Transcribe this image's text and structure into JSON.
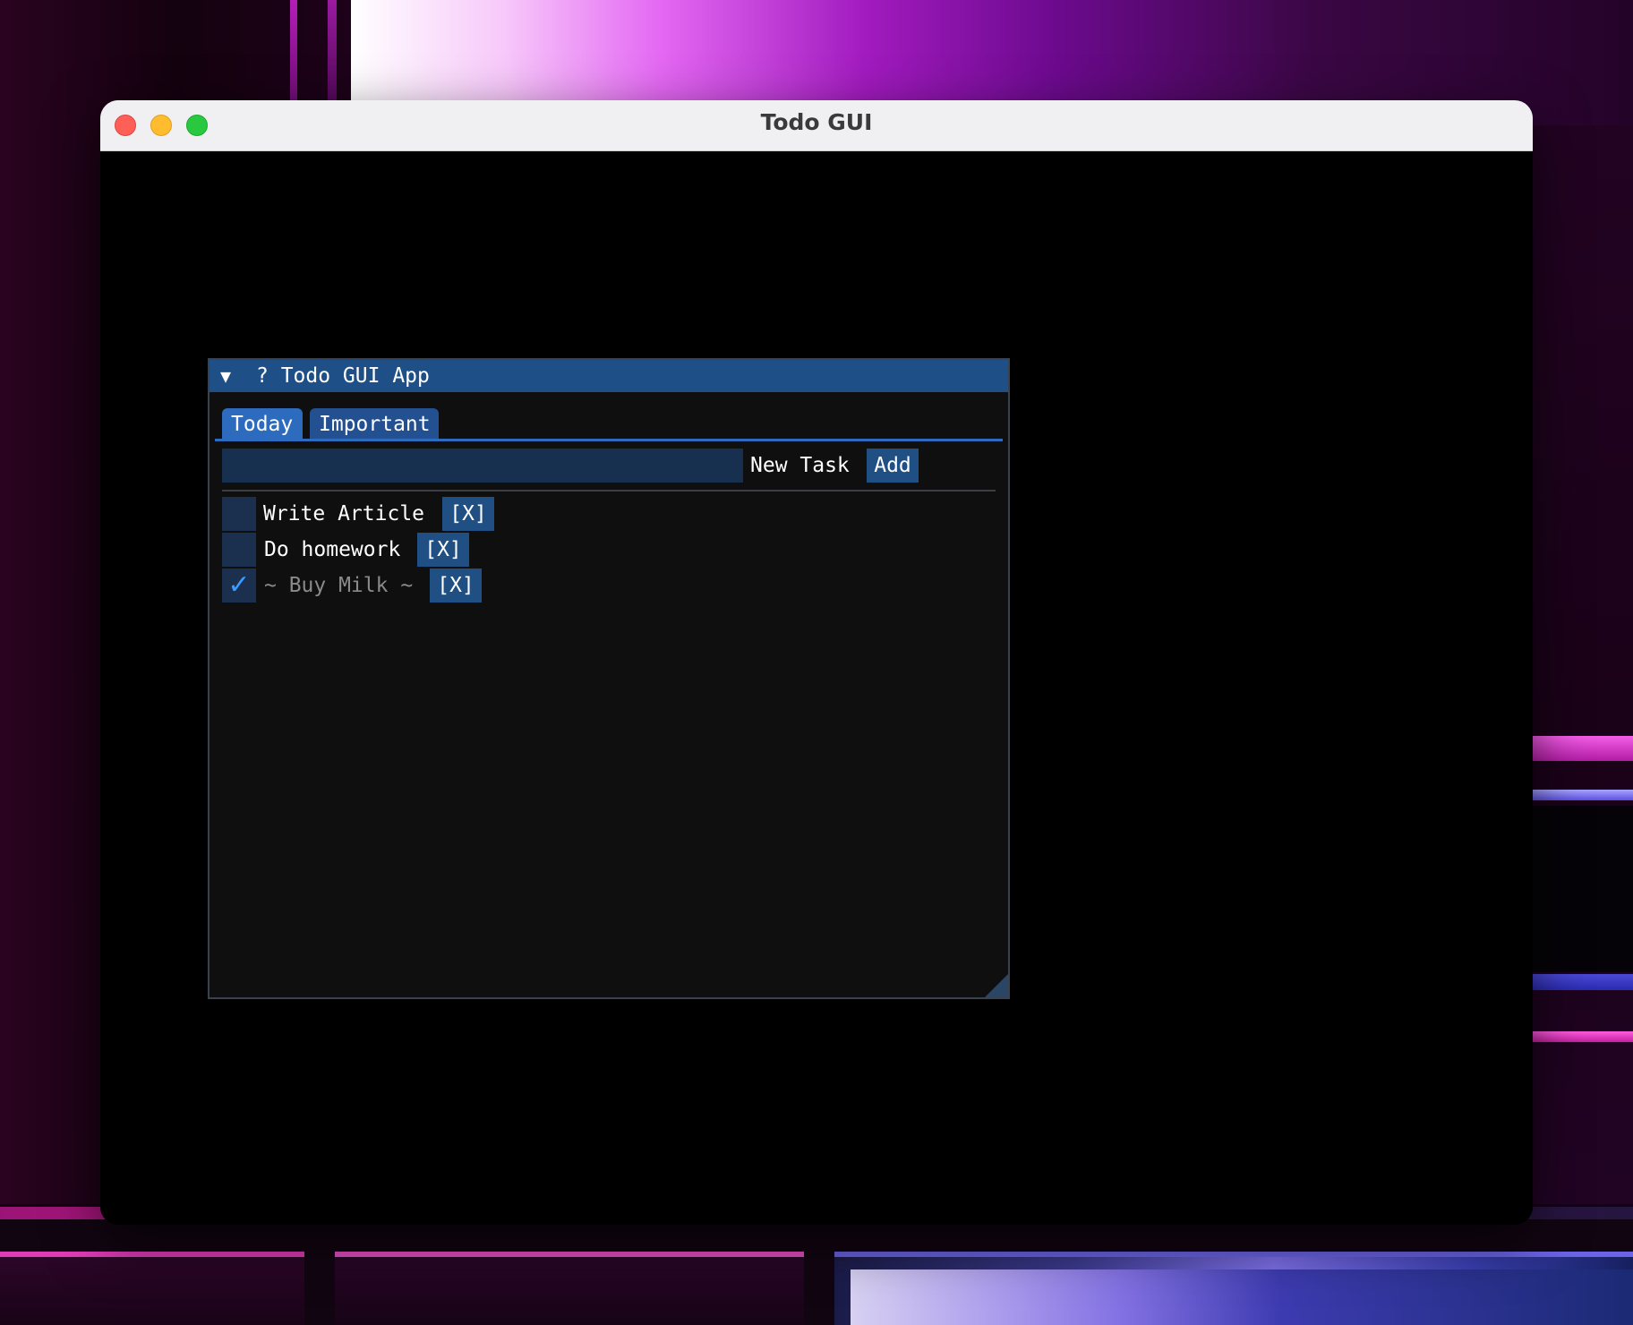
{
  "window": {
    "title": "Todo GUI"
  },
  "panel": {
    "title": "? Todo GUI App",
    "collapse_icon": "triangle-down-icon"
  },
  "tabs": [
    {
      "label": "Today",
      "active": true
    },
    {
      "label": "Important",
      "active": false
    }
  ],
  "new_task": {
    "value": "",
    "label": "New Task",
    "add_label": "Add"
  },
  "tasks": [
    {
      "label": "Write Article",
      "done": false,
      "delete_label": "[X]"
    },
    {
      "label": "Do homework",
      "done": false,
      "delete_label": "[X]"
    },
    {
      "label": "~ Buy Milk ~",
      "done": true,
      "delete_label": "[X]"
    }
  ],
  "colors": {
    "title_bar": "#1e4f87",
    "tab_active": "#2c6bbd",
    "button": "#1f4f83",
    "checkmark": "#3b9bff",
    "panel_bg": "#0f0f0f"
  }
}
